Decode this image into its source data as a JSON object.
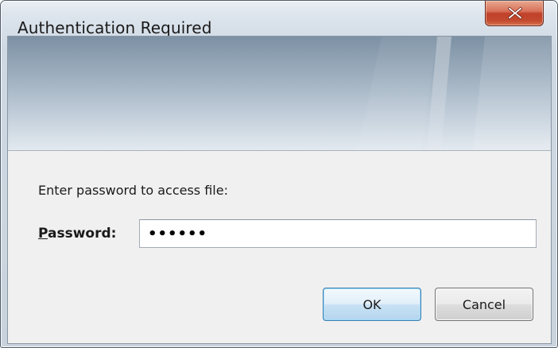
{
  "window": {
    "title": "Authentication Required"
  },
  "titlebar": {
    "close_icon": "close-x-icon",
    "close_color": "#c7432b"
  },
  "dialog": {
    "prompt": "Enter password to access file:",
    "password_label_mnemonic": "P",
    "password_label_rest": "assword:",
    "password_value": "••••••",
    "ok_label": "OK",
    "cancel_label": "Cancel",
    "banner_style": "aero-gradient"
  }
}
